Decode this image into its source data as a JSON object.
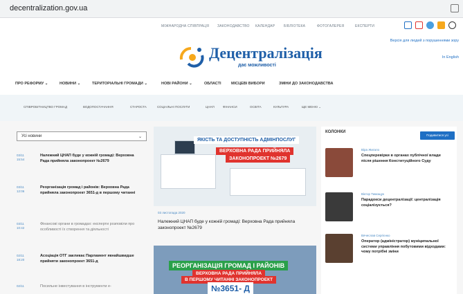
{
  "browser": {
    "url": "decentralization.gov.ua"
  },
  "topbar": {
    "links": [
      "МІЖНАРОДНА СПІВПРАЦЯ",
      "ЗАКОНОДАВСТВО",
      "КАЛЕНДАР",
      "БІБЛІОТЕКА",
      "ФОТОГАЛЕРЕЯ",
      "ЕКСПЕРТИ"
    ]
  },
  "logo": {
    "name": "Децентралізація",
    "tagline": "дає можливості"
  },
  "header": {
    "impaired_link": "Версія для людей з порушеннями зору",
    "english_link": "In English"
  },
  "main_nav": [
    "ПРО РЕФОРМУ ⌄",
    "НОВИНИ ⌄",
    "ТЕРИТОРІАЛЬНІ ГРОМАДИ ⌄",
    "НОВІ РАЙОНИ ⌄",
    "ОБЛАСТІ",
    "МІСЦЕВІ ВИБОРИ",
    "ЗМІНИ ДО ЗАКОНОДАВСТВА"
  ],
  "sub_nav": [
    "СПІВРОБІТНИЦТВО ГРОМАД",
    "ВОДОПОСТАЧАННЯ",
    "СТАРОСТА",
    "СОЦІАЛЬНІ ПОСЛУГИ",
    "ЦНАП",
    "ФІНАНСИ",
    "ОСВІТА",
    "КУЛЬТУРА",
    "ЩЕ МЕНЮ ⌄"
  ],
  "news_filter": {
    "selected": "Усі новини"
  },
  "news": [
    {
      "date": "03/11\n15:54",
      "title": "Належний ЦНАП буде у кожній громаді: Верховна Рада прийняла законопроект №2679",
      "bold": true
    },
    {
      "date": "03/11\n12:06",
      "title": "Реорганізація громад і районів: Верховна Рада прийняла законопроект 3651-д в першому читанні",
      "bold": true
    },
    {
      "date": "03/11\n10:42",
      "title": "Фінансові органи в громадах: експерти розповіли про особливості їх створення та діяльності",
      "bold": false
    },
    {
      "date": "02/11\n18:20",
      "title": "Асоціація ОТГ закликає Парламент якнайшвидше прийняти законопроект 3651-д",
      "bold": true
    },
    {
      "date": "02/11",
      "title": "Посильне інвестування в інструменти е-",
      "bold": false
    }
  ],
  "featured": {
    "banner_top": "ЯКІСТЬ ТА ДОСТУПНІСТЬ АДМІНПОСЛУГ",
    "banner_red1": "ВЕРХОВНА РАДА ПРИЙНЯЛА",
    "banner_red2": "ЗАКОНОПРОЕКТ №2679",
    "date": "03 листопада 2020",
    "title": "Належний ЦНАП буде у кожній громаді: Верховна Рада прийняла законопроект №2679"
  },
  "second": {
    "banner_top": "РЕОРГАНІЗАЦІЯ ГРОМАД І РАЙОНІВ",
    "banner_red1": "ВЕРХОВНА РАДА ПРИЙНЯЛА",
    "banner_red2": "В ПЕРШОМУ ЧИТАННІ ЗАКОНОПРОЕКТ",
    "number": "№3651- Д"
  },
  "columns": {
    "heading": "КОЛОНКИ",
    "subscribe": "Подивитися усі",
    "items": [
      {
        "author": "Віра Жигало",
        "title": "Спецперевірки в органах публічної влади після рішення Конституційного Суду"
      },
      {
        "author": "Віктор Тимощук",
        "title": "Парадокси децентралізації: централізація соціалізується?"
      },
      {
        "author": "Вячеслав Сергієнко",
        "title": "Оператор (адміністратор) муніципальної системи управління побутовими відходами: чому потрібні зміни"
      }
    ]
  },
  "colors": {
    "brand": "#1f5fa8",
    "accent_orange": "#f6a81c",
    "red": "#e0332e",
    "link": "#1f6fc4"
  }
}
